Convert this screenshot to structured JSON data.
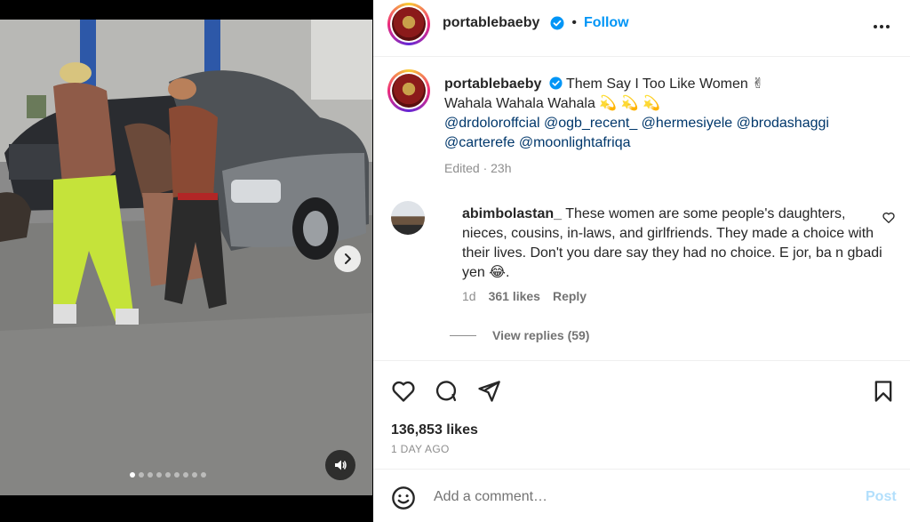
{
  "post": {
    "username": "portablebaeby",
    "follow_label": "Follow",
    "more_icon": "more-horizontal-icon"
  },
  "caption": {
    "username": "portablebaeby",
    "line1": "Them Say I Too Like Women ✌",
    "line2": "Wahala Wahala Wahala 💫 💫 💫",
    "mentions_line1": [
      "@drdoloroffcial",
      "@ogb_recent_",
      "@hermesiyele",
      "@brodashaggi"
    ],
    "mentions_line2": [
      "@carterefe",
      "@moonlightafriqa"
    ],
    "edited": "Edited · 23h"
  },
  "comment": {
    "username": "abimbolastan_",
    "text": "These women are some people's daughters, nieces, cousins, in-laws, and girlfriends. They made a choice with their lives. Don't you dare say they had no choice. E jor, ba n gbadi yen 😂.",
    "age": "1d",
    "likes": "361 likes",
    "reply_label": "Reply",
    "view_replies": "View replies (59)"
  },
  "stats": {
    "likes": "136,853 likes",
    "date": "1 DAY AGO"
  },
  "add_comment": {
    "placeholder": "Add a comment…",
    "post_label": "Post"
  },
  "carousel": {
    "slide_count": 9,
    "active_index": 0
  },
  "colors": {
    "accent": "#0095f6",
    "mention": "#00376b",
    "muted": "#8e8e8e",
    "post_disabled": "#b2dffc"
  }
}
